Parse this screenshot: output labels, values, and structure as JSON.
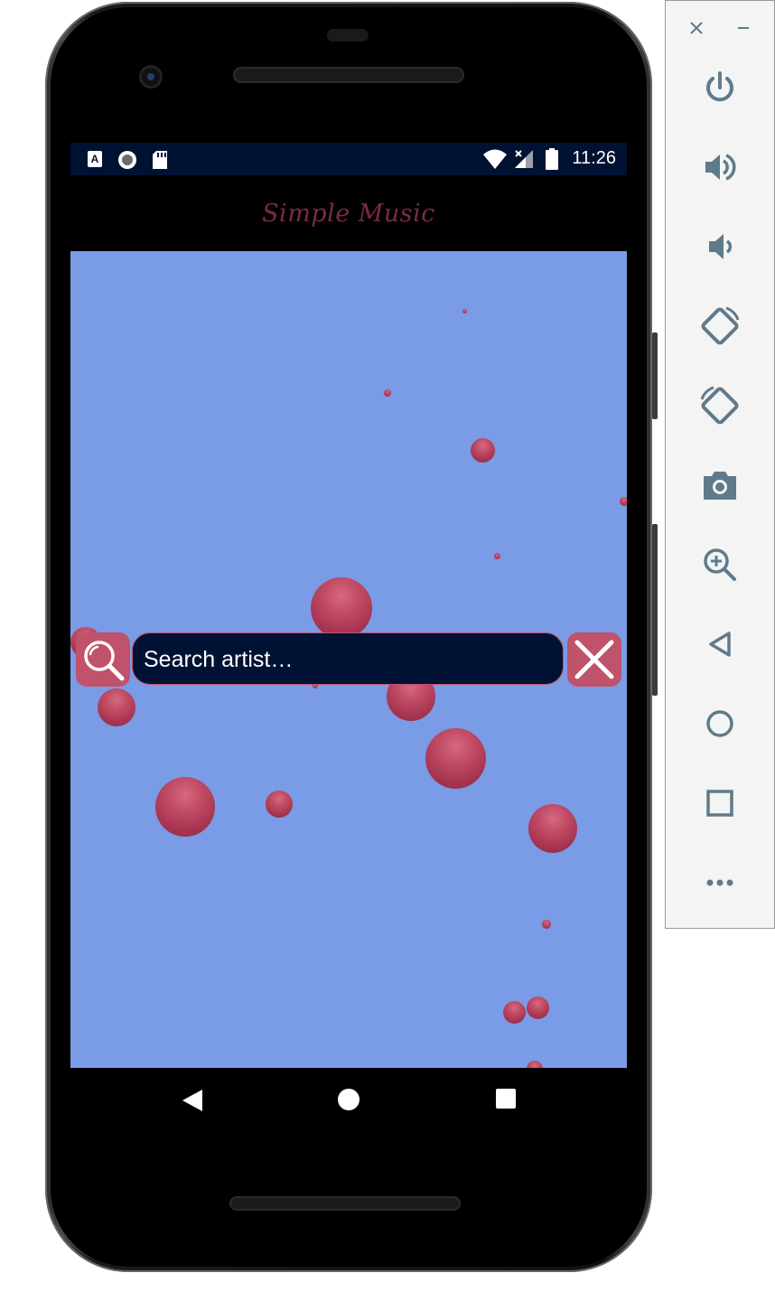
{
  "statusbar": {
    "time": "11:26",
    "icons": [
      "a-notification-icon",
      "record-icon",
      "sd-card-icon",
      "wifi-icon",
      "signal-icon",
      "battery-icon"
    ]
  },
  "app": {
    "title": "Simple Music",
    "search": {
      "placeholder": "Search artist…",
      "value": ""
    }
  },
  "navbar": {
    "buttons": [
      "back",
      "home",
      "recents"
    ]
  },
  "emulator_toolbar": {
    "top": [
      "close",
      "minimize"
    ],
    "buttons": [
      "power",
      "volume-up",
      "volume-down",
      "rotate-left",
      "rotate-right",
      "screenshot",
      "zoom",
      "back",
      "home",
      "overview",
      "more"
    ]
  },
  "colors": {
    "background": "#7a9be6",
    "accent": "#c0526b",
    "navy": "#001233",
    "title": "#7a2b44"
  }
}
